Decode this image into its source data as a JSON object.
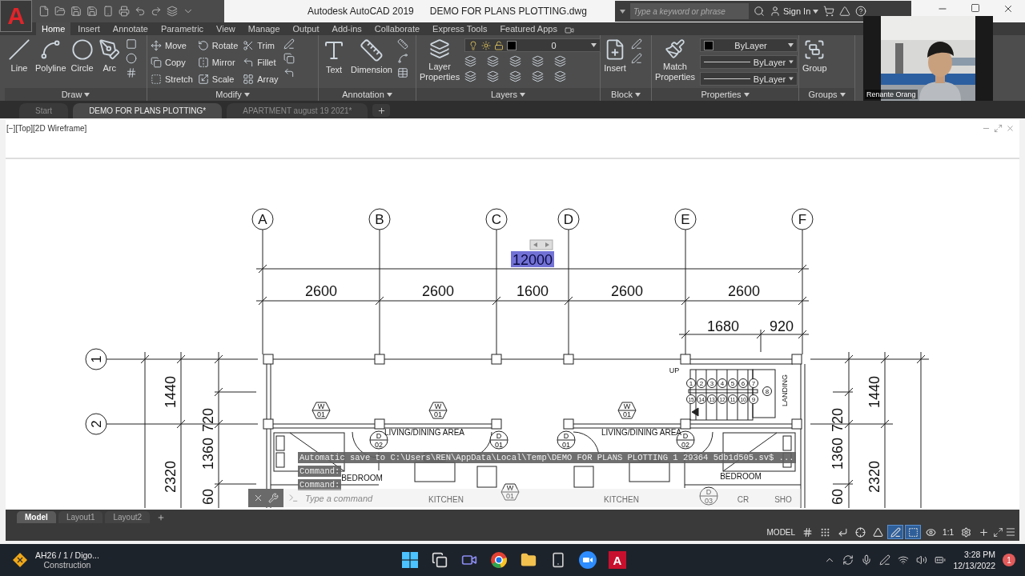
{
  "app_button": {
    "letter": "A"
  },
  "window": {
    "title": "Autodesk AutoCAD 2019",
    "file": "DEMO FOR PLANS PLOTTING.dwg"
  },
  "search": {
    "placeholder": "Type a keyword or phrase"
  },
  "sign_in": "Sign In",
  "ribbon_tabs": [
    {
      "label": "Home",
      "selected": true
    },
    {
      "label": "Insert",
      "selected": false
    },
    {
      "label": "Annotate",
      "selected": false
    },
    {
      "label": "Parametric",
      "selected": false
    },
    {
      "label": "View",
      "selected": false
    },
    {
      "label": "Manage",
      "selected": false
    },
    {
      "label": "Output",
      "selected": false
    },
    {
      "label": "Add-ins",
      "selected": false
    },
    {
      "label": "Collaborate",
      "selected": false
    },
    {
      "label": "Express Tools",
      "selected": false
    },
    {
      "label": "Featured Apps",
      "selected": false
    }
  ],
  "draw_panel": {
    "title": "Draw",
    "tools": [
      "Line",
      "Polyline",
      "Circle",
      "Arc"
    ]
  },
  "modify_panel": {
    "title": "Modify",
    "tools": [
      "Move",
      "Rotate",
      "Trim",
      "Copy",
      "Mirror",
      "Fillet",
      "Stretch",
      "Scale",
      "Array"
    ]
  },
  "annotation_panel": {
    "title": "Annotation",
    "tools": [
      "Text",
      "Dimension"
    ]
  },
  "layers_panel": {
    "title": "Layers",
    "tool": "Layer Properties",
    "current_layer": "0"
  },
  "block_panel": {
    "title": "Block",
    "tool": "Insert"
  },
  "properties_panel": {
    "title": "Properties",
    "tool": "Match Properties",
    "color_setting": "ByLayer",
    "linetype": "ByLayer",
    "lineweight": "ByLayer"
  },
  "groups_panel": {
    "title": "Groups",
    "tool": "Group"
  },
  "webcam": {
    "name": "Renante Orang"
  },
  "file_tabs": [
    {
      "label": "Start",
      "selected": false
    },
    {
      "label": "DEMO FOR PLANS PLOTTING*",
      "selected": true
    },
    {
      "label": "APARTMENT august 19 2021*",
      "selected": false
    }
  ],
  "viewport": {
    "label": "[−][Top][2D Wireframe]"
  },
  "drawing": {
    "grid_columns": [
      "A",
      "B",
      "C",
      "D",
      "E",
      "F"
    ],
    "grid_rows": [
      "1",
      "2"
    ],
    "overall_dimension": {
      "text": "12000",
      "selected": true
    },
    "bay_dimensions": [
      "2600",
      "2600",
      "1600",
      "2600",
      "2600"
    ],
    "stair_dimensions": [
      "1680",
      "920"
    ],
    "left_dimensions": [
      "1440",
      "2320",
      "720",
      "1360",
      "60"
    ],
    "right_dimensions": [
      "1440",
      "2320",
      "720",
      "1360",
      "60"
    ],
    "stair_labels": [
      "UP",
      "LANDING"
    ],
    "stair_numbers": [
      "1",
      "2",
      "3",
      "4",
      "5",
      "6",
      "7",
      "8",
      "15",
      "14",
      "13",
      "12",
      "11",
      "10",
      "9"
    ],
    "window_tags": [
      {
        "letter": "W",
        "number": "01"
      },
      {
        "letter": "W",
        "number": "01"
      },
      {
        "letter": "W",
        "number": "01"
      },
      {
        "letter": "W",
        "number": "01"
      }
    ],
    "door_tags": [
      {
        "letter": "D",
        "number": "02"
      },
      {
        "letter": "D",
        "number": "01"
      },
      {
        "letter": "D",
        "number": "01"
      },
      {
        "letter": "D",
        "number": "02"
      },
      {
        "letter": "D",
        "number": "03"
      }
    ],
    "room_labels": [
      "LIVING/DINING AREA",
      "LIVING/DINING AREA",
      "BEDROOM",
      "BEDROOM",
      "KITCHEN",
      "KITCHEN",
      "CR",
      "SHO"
    ]
  },
  "command_line": {
    "history": [
      "Automatic save to C:\\Users\\REN\\AppData\\Local\\Temp\\DEMO FOR PLANS PLOTTING 1 29364 5db1d505.sv$ ...",
      "Command:",
      "Command:"
    ],
    "placeholder": "Type a command"
  },
  "layout_tabs": [
    {
      "label": "Model",
      "selected": true
    },
    {
      "label": "Layout1",
      "selected": false
    },
    {
      "label": "Layout2",
      "selected": false
    }
  ],
  "status_bar": {
    "space": "MODEL",
    "scale": "1:1",
    "toggles": [
      {
        "on": false
      },
      {
        "on": false
      },
      {
        "on": false
      },
      {
        "on": false
      },
      {
        "on": false
      },
      {
        "on": true
      },
      {
        "on": true
      },
      {
        "on": false
      },
      {
        "on": false
      },
      {
        "on": false
      }
    ]
  },
  "taskbar": {
    "widget_title": "AH26 / 1 / Digo...",
    "widget_subtitle": "Construction",
    "app_letter": "A",
    "time": "3:28 PM",
    "date": "12/13/2022",
    "notifications": "1"
  }
}
